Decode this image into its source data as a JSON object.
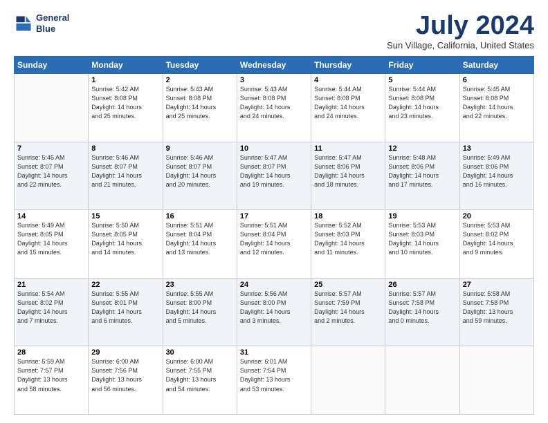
{
  "logo": {
    "line1": "General",
    "line2": "Blue"
  },
  "title": "July 2024",
  "location": "Sun Village, California, United States",
  "weekdays": [
    "Sunday",
    "Monday",
    "Tuesday",
    "Wednesday",
    "Thursday",
    "Friday",
    "Saturday"
  ],
  "weeks": [
    [
      {
        "day": "",
        "info": ""
      },
      {
        "day": "1",
        "info": "Sunrise: 5:42 AM\nSunset: 8:08 PM\nDaylight: 14 hours\nand 25 minutes."
      },
      {
        "day": "2",
        "info": "Sunrise: 5:43 AM\nSunset: 8:08 PM\nDaylight: 14 hours\nand 25 minutes."
      },
      {
        "day": "3",
        "info": "Sunrise: 5:43 AM\nSunset: 8:08 PM\nDaylight: 14 hours\nand 24 minutes."
      },
      {
        "day": "4",
        "info": "Sunrise: 5:44 AM\nSunset: 8:08 PM\nDaylight: 14 hours\nand 24 minutes."
      },
      {
        "day": "5",
        "info": "Sunrise: 5:44 AM\nSunset: 8:08 PM\nDaylight: 14 hours\nand 23 minutes."
      },
      {
        "day": "6",
        "info": "Sunrise: 5:45 AM\nSunset: 8:08 PM\nDaylight: 14 hours\nand 22 minutes."
      }
    ],
    [
      {
        "day": "7",
        "info": "Sunrise: 5:45 AM\nSunset: 8:07 PM\nDaylight: 14 hours\nand 22 minutes."
      },
      {
        "day": "8",
        "info": "Sunrise: 5:46 AM\nSunset: 8:07 PM\nDaylight: 14 hours\nand 21 minutes."
      },
      {
        "day": "9",
        "info": "Sunrise: 5:46 AM\nSunset: 8:07 PM\nDaylight: 14 hours\nand 20 minutes."
      },
      {
        "day": "10",
        "info": "Sunrise: 5:47 AM\nSunset: 8:07 PM\nDaylight: 14 hours\nand 19 minutes."
      },
      {
        "day": "11",
        "info": "Sunrise: 5:47 AM\nSunset: 8:06 PM\nDaylight: 14 hours\nand 18 minutes."
      },
      {
        "day": "12",
        "info": "Sunrise: 5:48 AM\nSunset: 8:06 PM\nDaylight: 14 hours\nand 17 minutes."
      },
      {
        "day": "13",
        "info": "Sunrise: 5:49 AM\nSunset: 8:06 PM\nDaylight: 14 hours\nand 16 minutes."
      }
    ],
    [
      {
        "day": "14",
        "info": "Sunrise: 5:49 AM\nSunset: 8:05 PM\nDaylight: 14 hours\nand 15 minutes."
      },
      {
        "day": "15",
        "info": "Sunrise: 5:50 AM\nSunset: 8:05 PM\nDaylight: 14 hours\nand 14 minutes."
      },
      {
        "day": "16",
        "info": "Sunrise: 5:51 AM\nSunset: 8:04 PM\nDaylight: 14 hours\nand 13 minutes."
      },
      {
        "day": "17",
        "info": "Sunrise: 5:51 AM\nSunset: 8:04 PM\nDaylight: 14 hours\nand 12 minutes."
      },
      {
        "day": "18",
        "info": "Sunrise: 5:52 AM\nSunset: 8:03 PM\nDaylight: 14 hours\nand 11 minutes."
      },
      {
        "day": "19",
        "info": "Sunrise: 5:53 AM\nSunset: 8:03 PM\nDaylight: 14 hours\nand 10 minutes."
      },
      {
        "day": "20",
        "info": "Sunrise: 5:53 AM\nSunset: 8:02 PM\nDaylight: 14 hours\nand 9 minutes."
      }
    ],
    [
      {
        "day": "21",
        "info": "Sunrise: 5:54 AM\nSunset: 8:02 PM\nDaylight: 14 hours\nand 7 minutes."
      },
      {
        "day": "22",
        "info": "Sunrise: 5:55 AM\nSunset: 8:01 PM\nDaylight: 14 hours\nand 6 minutes."
      },
      {
        "day": "23",
        "info": "Sunrise: 5:55 AM\nSunset: 8:00 PM\nDaylight: 14 hours\nand 5 minutes."
      },
      {
        "day": "24",
        "info": "Sunrise: 5:56 AM\nSunset: 8:00 PM\nDaylight: 14 hours\nand 3 minutes."
      },
      {
        "day": "25",
        "info": "Sunrise: 5:57 AM\nSunset: 7:59 PM\nDaylight: 14 hours\nand 2 minutes."
      },
      {
        "day": "26",
        "info": "Sunrise: 5:57 AM\nSunset: 7:58 PM\nDaylight: 14 hours\nand 0 minutes."
      },
      {
        "day": "27",
        "info": "Sunrise: 5:58 AM\nSunset: 7:58 PM\nDaylight: 13 hours\nand 59 minutes."
      }
    ],
    [
      {
        "day": "28",
        "info": "Sunrise: 5:59 AM\nSunset: 7:57 PM\nDaylight: 13 hours\nand 58 minutes."
      },
      {
        "day": "29",
        "info": "Sunrise: 6:00 AM\nSunset: 7:56 PM\nDaylight: 13 hours\nand 56 minutes."
      },
      {
        "day": "30",
        "info": "Sunrise: 6:00 AM\nSunset: 7:55 PM\nDaylight: 13 hours\nand 54 minutes."
      },
      {
        "day": "31",
        "info": "Sunrise: 6:01 AM\nSunset: 7:54 PM\nDaylight: 13 hours\nand 53 minutes."
      },
      {
        "day": "",
        "info": ""
      },
      {
        "day": "",
        "info": ""
      },
      {
        "day": "",
        "info": ""
      }
    ]
  ]
}
